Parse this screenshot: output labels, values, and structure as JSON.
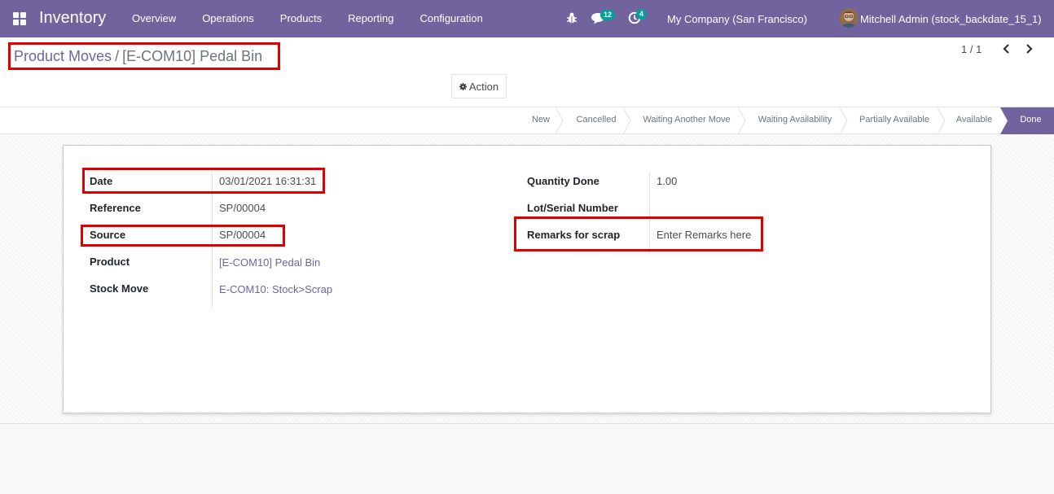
{
  "navbar": {
    "app_name": "Inventory",
    "menu": [
      "Overview",
      "Operations",
      "Products",
      "Reporting",
      "Configuration"
    ],
    "messages_count": "12",
    "activities_count": "4",
    "company": "My Company (San Francisco)",
    "user": "Mitchell Admin (stock_backdate_15_1)"
  },
  "breadcrumb": {
    "parent": "Product Moves",
    "separator": "/",
    "current": "[E-COM10] Pedal Bin"
  },
  "toolbar": {
    "action_label": "Action"
  },
  "pager": {
    "value": "1 / 1"
  },
  "statusbar": {
    "stages": [
      "New",
      "Cancelled",
      "Waiting Another Move",
      "Waiting Availability",
      "Partially Available",
      "Available",
      "Done"
    ],
    "active": "Done"
  },
  "form": {
    "left": [
      {
        "label": "Date",
        "value": "03/01/2021 16:31:31"
      },
      {
        "label": "Reference",
        "value": "SP/00004"
      },
      {
        "label": "Source",
        "value": "SP/00004"
      },
      {
        "label": "Product",
        "value": "[E-COM10] Pedal Bin"
      },
      {
        "label": "Stock Move",
        "value": "E-COM10: Stock>Scrap"
      }
    ],
    "right": [
      {
        "label": "Quantity Done",
        "value": "1.00"
      },
      {
        "label": "Lot/Serial Number",
        "value": ""
      },
      {
        "label": "Remarks for scrap",
        "value": "Enter Remarks here"
      }
    ]
  },
  "colors": {
    "brand": "#71639e",
    "badge": "#00a09d",
    "highlight": "#e00000"
  }
}
